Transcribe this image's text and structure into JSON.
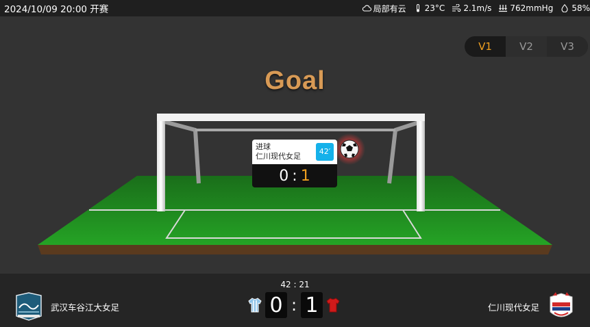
{
  "header": {
    "datetime": "2024/10/09 20:00 开赛",
    "weather": {
      "condition": "局部有云",
      "temperature": "23°C",
      "wind": "2.1m/s",
      "pressure": "762mmHg",
      "humidity": "58%"
    }
  },
  "view_tabs": [
    "V1",
    "V2",
    "V3"
  ],
  "animation": {
    "title": "Goal",
    "event_label": "进球",
    "event_team": "仁川现代女足",
    "event_minute": "42′",
    "score_home": "0",
    "score_sep": ":",
    "score_away": "1"
  },
  "scoreboard": {
    "match_clock": "42 : 21",
    "home_team": "武汉车谷江大女足",
    "away_team": "仁川现代女足",
    "home_score": "0",
    "away_score": "1",
    "separator": ":"
  },
  "colors": {
    "accent": "#f0a020",
    "minute_badge": "#15b1ea",
    "pitch": "#1f8a1f",
    "home_kit": "#8fc3e8",
    "away_kit": "#d01a1a"
  }
}
